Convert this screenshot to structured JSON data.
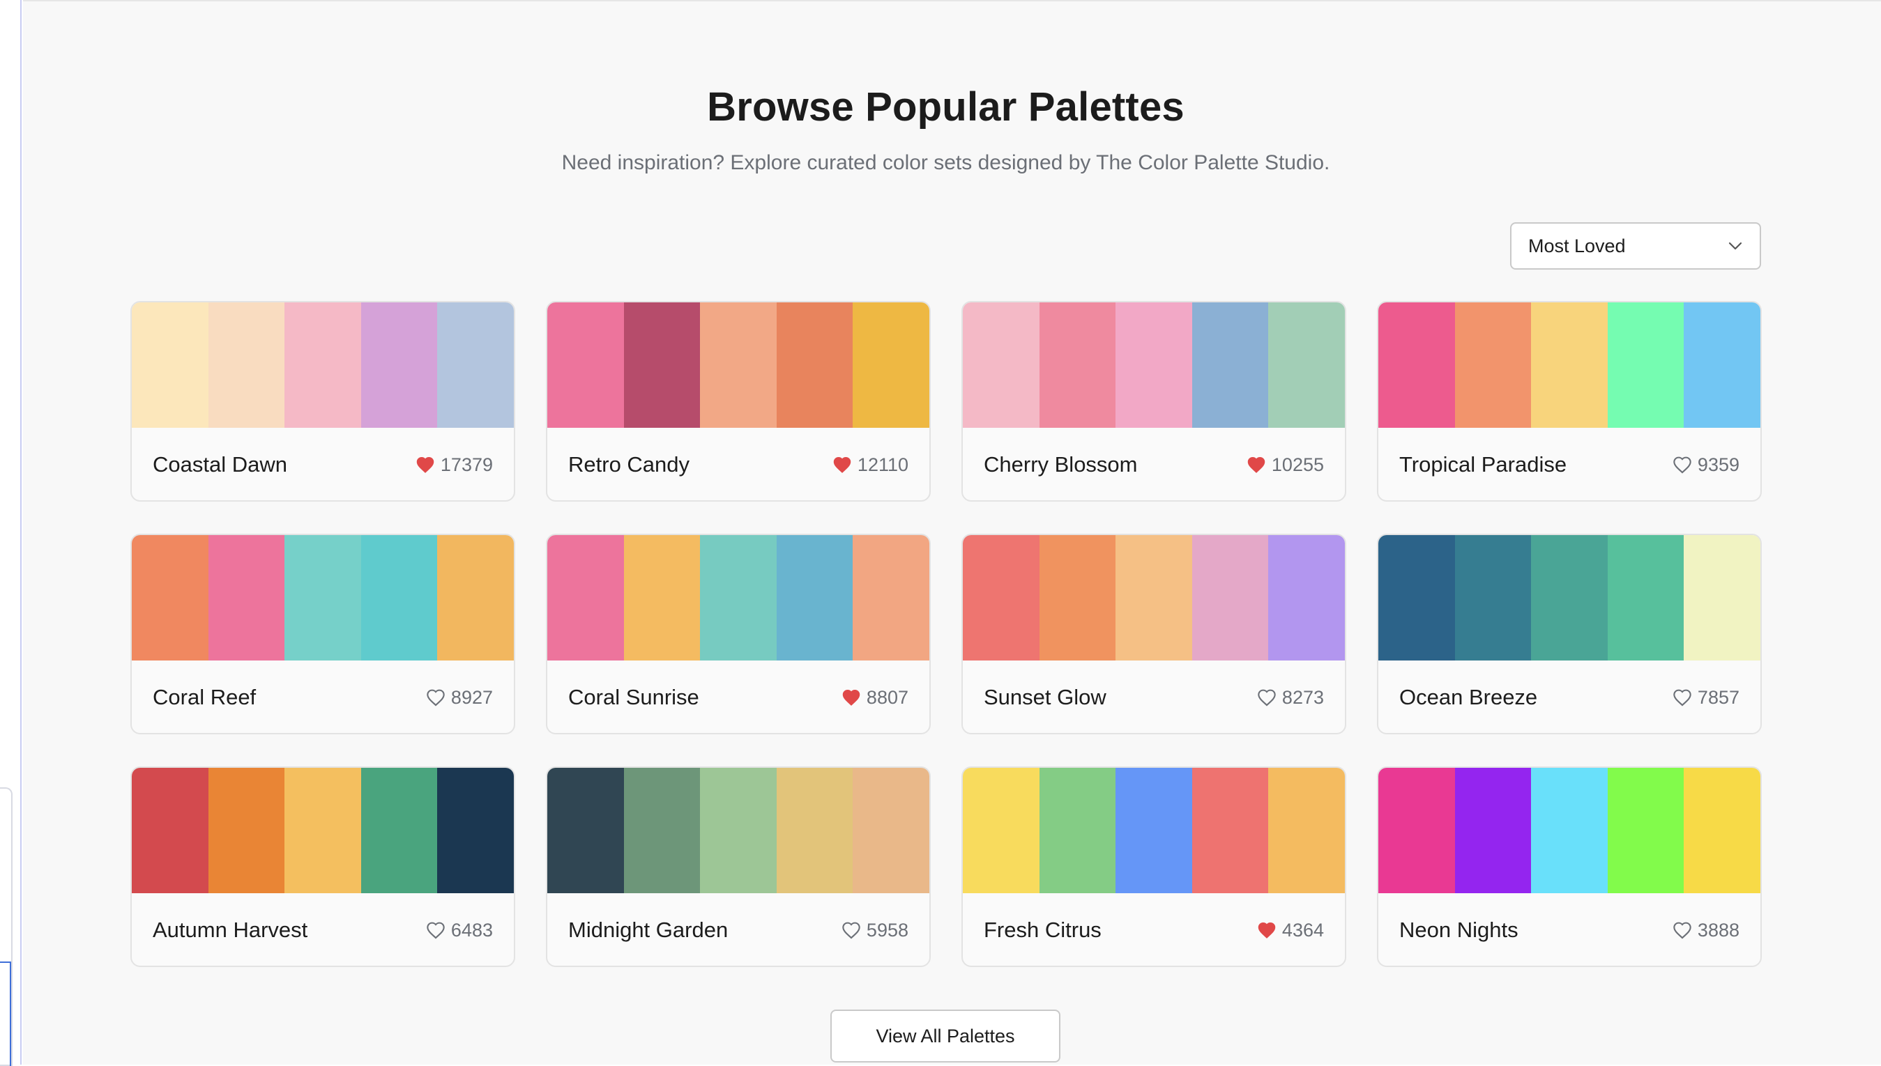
{
  "header": {
    "title": "Browse Popular Palettes",
    "subtitle": "Need inspiration? Explore curated color sets designed by The Color Palette Studio."
  },
  "sort": {
    "selected": "Most Loved",
    "icon": "chevron-down-icon"
  },
  "palettes": [
    {
      "name": "Coastal Dawn",
      "likes": "17379",
      "loved": true,
      "colors": [
        "#fce7bb",
        "#f9dcc0",
        "#f5b9c6",
        "#d5a2d8",
        "#b3c5de"
      ]
    },
    {
      "name": "Retro Candy",
      "likes": "12110",
      "loved": true,
      "colors": [
        "#ed749c",
        "#b64c6b",
        "#f2a886",
        "#e8845d",
        "#eeb843"
      ]
    },
    {
      "name": "Cherry Blossom",
      "likes": "10255",
      "loved": true,
      "colors": [
        "#f4b9c6",
        "#ef8a9f",
        "#f2a8c6",
        "#8bb0d4",
        "#a2ceb6"
      ]
    },
    {
      "name": "Tropical Paradise",
      "likes": "9359",
      "loved": false,
      "colors": [
        "#ed5b8e",
        "#f2946c",
        "#f8d47c",
        "#75fcb1",
        "#72c6f3"
      ]
    },
    {
      "name": "Coral Reef",
      "likes": "8927",
      "loved": false,
      "colors": [
        "#f08860",
        "#ed749c",
        "#76d0c9",
        "#5fcbcd",
        "#f2b75f"
      ]
    },
    {
      "name": "Coral Sunrise",
      "likes": "8807",
      "loved": true,
      "colors": [
        "#ed749c",
        "#f4bb61",
        "#77cbc1",
        "#69b4cf",
        "#f2a682"
      ]
    },
    {
      "name": "Sunset Glow",
      "likes": "8273",
      "loved": false,
      "colors": [
        "#ee7570",
        "#f0935f",
        "#f5c085",
        "#e4a8c8",
        "#b296ef"
      ]
    },
    {
      "name": "Ocean Breeze",
      "likes": "7857",
      "loved": false,
      "colors": [
        "#2c6389",
        "#367d91",
        "#4aa596",
        "#57c09c",
        "#f1f3c2"
      ]
    },
    {
      "name": "Autumn Harvest",
      "likes": "6483",
      "loved": false,
      "colors": [
        "#d34a4e",
        "#e98535",
        "#f4bf5f",
        "#4aa47e",
        "#1b3751"
      ]
    },
    {
      "name": "Midnight Garden",
      "likes": "5958",
      "loved": false,
      "colors": [
        "#304653",
        "#6d9679",
        "#9dc696",
        "#e2c47a",
        "#e9b889"
      ]
    },
    {
      "name": "Fresh Citrus",
      "likes": "4364",
      "loved": true,
      "colors": [
        "#f8db5d",
        "#84cc85",
        "#6596f7",
        "#ee7370",
        "#f4bb60"
      ]
    },
    {
      "name": "Neon Nights",
      "likes": "3888",
      "loved": false,
      "colors": [
        "#e93993",
        "#9425ef",
        "#69e0fa",
        "#82fb4b",
        "#f7da47"
      ]
    }
  ],
  "colors": {
    "heart_loved": "#e04848",
    "heart_outline": "#6b6f76"
  },
  "footer": {
    "view_all_label": "View All Palettes"
  }
}
